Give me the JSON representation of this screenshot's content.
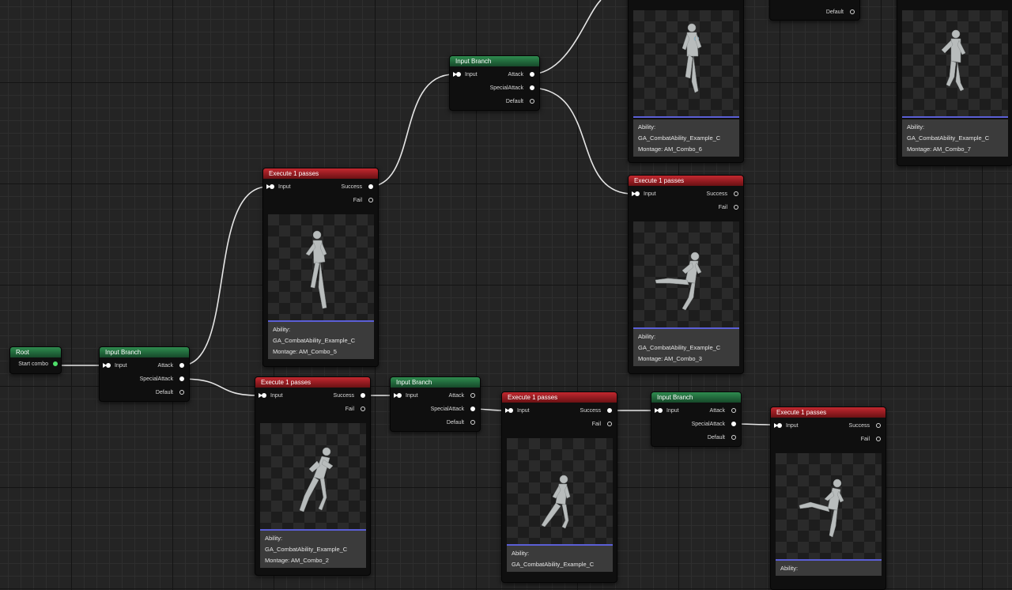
{
  "nodes": {
    "root": {
      "title": "Root",
      "output": "Start combo"
    },
    "branch_a": {
      "title": "Input Branch",
      "input": "Input",
      "outputs": [
        "Attack",
        "SpecialAttack",
        "Default"
      ]
    },
    "branch_b": {
      "title": "Input Branch",
      "input": "Input",
      "outputs": [
        "Attack",
        "SpecialAttack",
        "Default"
      ]
    },
    "branch_c": {
      "title": "Input Branch",
      "input": "Input",
      "outputs": [
        "Attack",
        "SpecialAttack",
        "Default"
      ]
    },
    "branch_d": {
      "title": "Input Branch",
      "input": "Input",
      "outputs": [
        "Attack",
        "SpecialAttack",
        "Default"
      ]
    },
    "branch_top": {
      "outputs": [
        "Default"
      ]
    },
    "exec_combo5": {
      "title": "Execute 1 passes",
      "input": "Input",
      "outputs": [
        "Success",
        "Fail"
      ],
      "ability_label": "Ability:",
      "ability": "GA_CombatAbility_Example_C",
      "montage": "Montage: AM_Combo_5"
    },
    "exec_combo2": {
      "title": "Execute 1 passes",
      "input": "Input",
      "outputs": [
        "Success",
        "Fail"
      ],
      "ability_label": "Ability:",
      "ability": "GA_CombatAbility_Example_C",
      "montage": "Montage: AM_Combo_2"
    },
    "exec_combo3": {
      "title": "Execute 1 passes",
      "input": "Input",
      "outputs": [
        "Success",
        "Fail"
      ],
      "ability_label": "Ability:",
      "ability": "GA_CombatAbility_Example_C",
      "montage": "Montage: AM_Combo_3"
    },
    "exec_combo6": {
      "ability_label": "Ability:",
      "ability": "GA_CombatAbility_Example_C",
      "montage": "Montage: AM_Combo_6"
    },
    "exec_combo7": {
      "ability_label": "Ability:",
      "ability": "GA_CombatAbility_Example_C",
      "montage": "Montage: AM_Combo_7"
    },
    "exec_mid": {
      "title": "Execute 1 passes",
      "input": "Input",
      "outputs": [
        "Success",
        "Fail"
      ],
      "ability_label": "Ability:",
      "ability": "GA_CombatAbility_Example_C"
    },
    "exec_right": {
      "title": "Execute 1 passes",
      "input": "Input",
      "outputs": [
        "Success",
        "Fail"
      ],
      "ability_label": "Ability:"
    }
  },
  "colors": {
    "branch_header": "#2f8c4f",
    "execute_header": "#c2282f",
    "wire": "#e6e6e6",
    "thumb_divider": "#5b5fd6"
  },
  "icons": {
    "input_pin": "exec-input-pin-icon",
    "output_pin": "output-pin-icon",
    "preview": "character-pose-preview"
  }
}
